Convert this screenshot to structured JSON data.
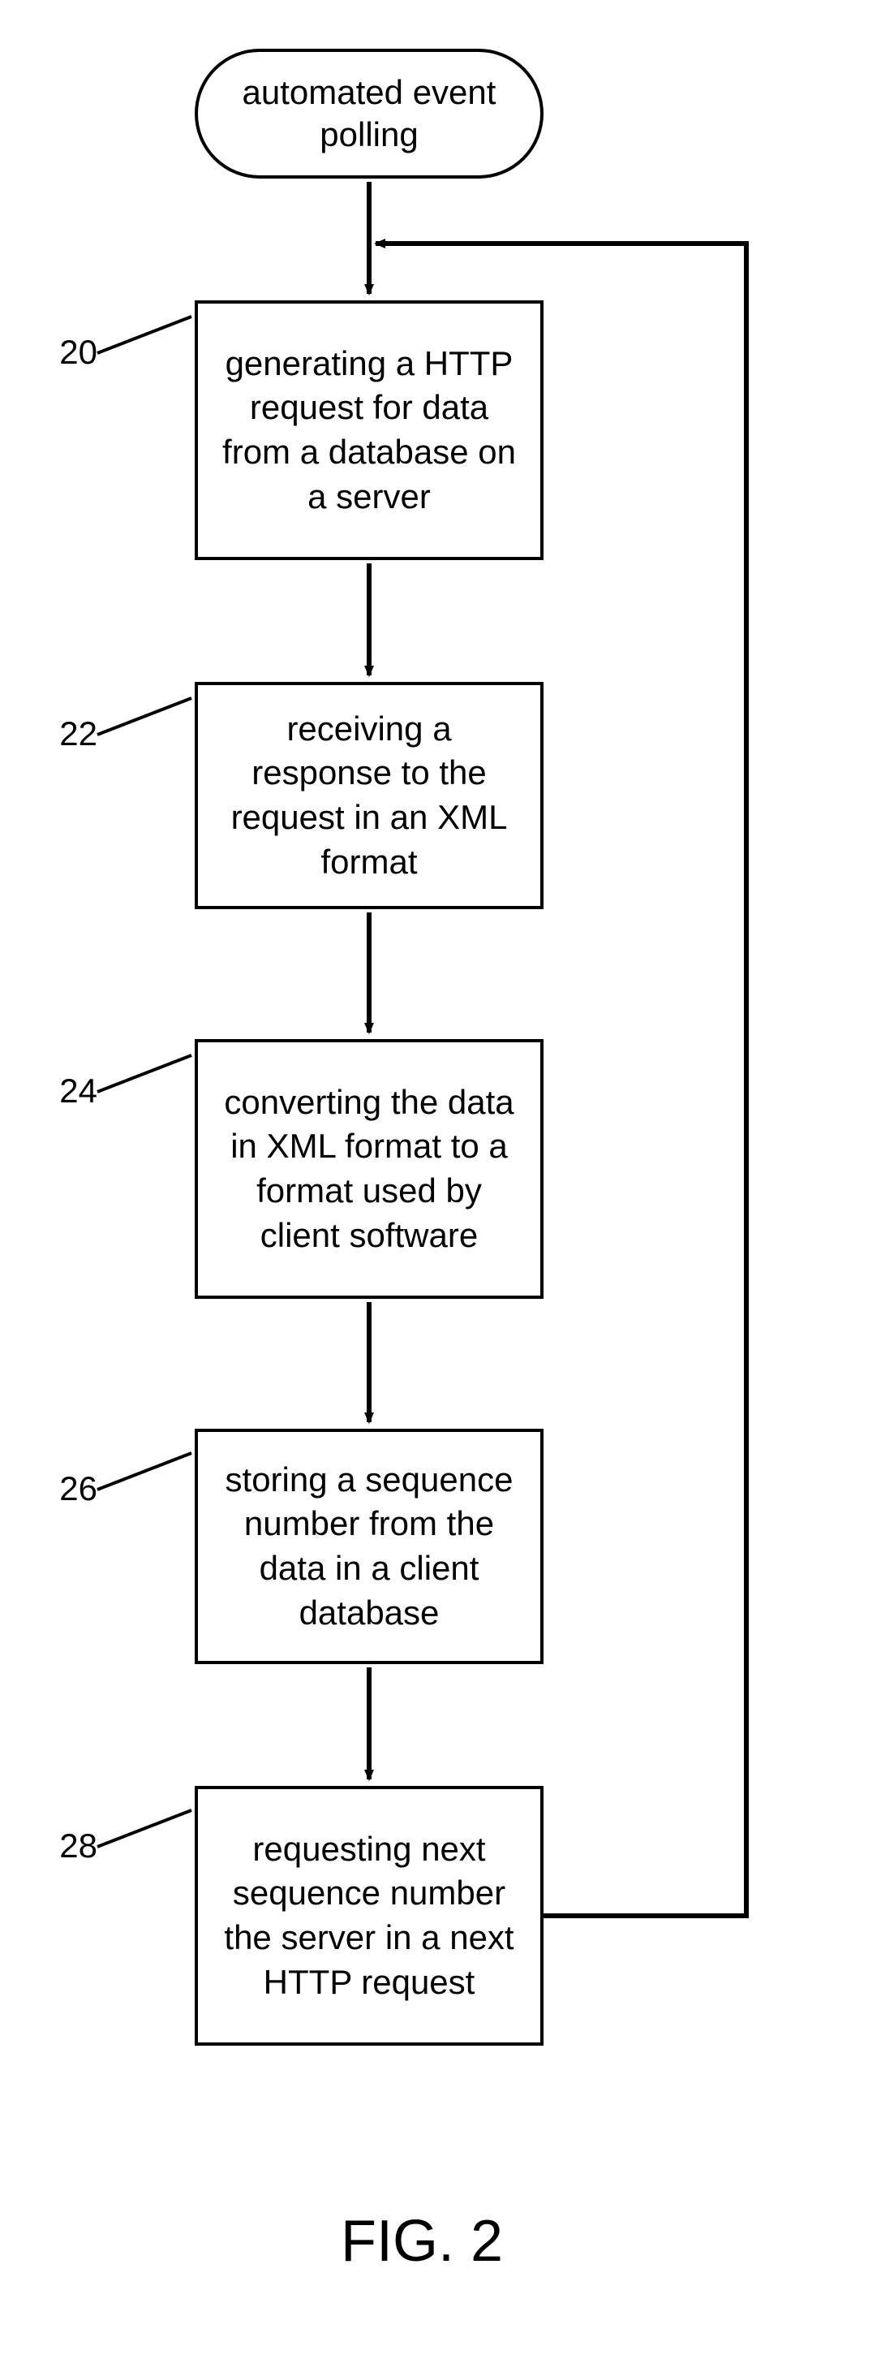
{
  "terminator": {
    "label": "automated event polling"
  },
  "steps": [
    {
      "num": "20",
      "text": "generating a HTTP request for data from a database on a server"
    },
    {
      "num": "22",
      "text": "receiving a response to the request in an XML format"
    },
    {
      "num": "24",
      "text": "converting the data in XML format to a format used by client software"
    },
    {
      "num": "26",
      "text": "storing a sequence number from the data in a client database"
    },
    {
      "num": "28",
      "text": "requesting next sequence number the server in a next HTTP request"
    }
  ],
  "figure_caption": "FIG. 2",
  "chart_data": {
    "type": "flowchart",
    "title": "automated event polling",
    "nodes": [
      {
        "id": "start",
        "type": "terminator",
        "label": "automated event polling"
      },
      {
        "id": "20",
        "type": "process",
        "label": "generating a HTTP request for data from a database on a server"
      },
      {
        "id": "22",
        "type": "process",
        "label": "receiving a response to the request in an XML format"
      },
      {
        "id": "24",
        "type": "process",
        "label": "converting the data in XML format to a format used by client software"
      },
      {
        "id": "26",
        "type": "process",
        "label": "storing a sequence number from the data in a client database"
      },
      {
        "id": "28",
        "type": "process",
        "label": "requesting next sequence number the server in a next HTTP request"
      }
    ],
    "edges": [
      {
        "from": "start",
        "to": "20"
      },
      {
        "from": "20",
        "to": "22"
      },
      {
        "from": "22",
        "to": "24"
      },
      {
        "from": "24",
        "to": "26"
      },
      {
        "from": "26",
        "to": "28"
      },
      {
        "from": "28",
        "to": "20",
        "kind": "loop"
      }
    ]
  }
}
